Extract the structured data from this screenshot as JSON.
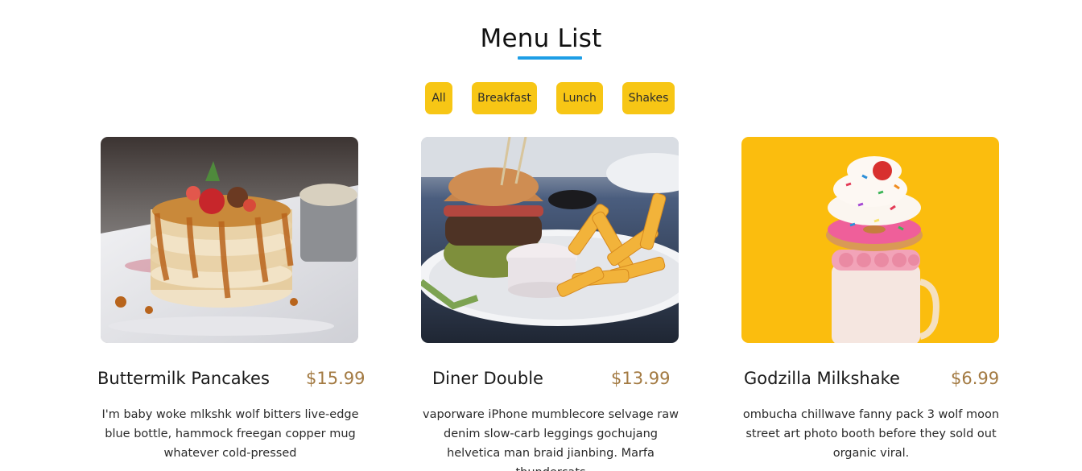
{
  "header": {
    "title": "Menu List"
  },
  "filters": [
    {
      "label": "All"
    },
    {
      "label": "Breakfast"
    },
    {
      "label": "Lunch"
    },
    {
      "label": "Shakes"
    }
  ],
  "menu_items": [
    {
      "name": "Buttermilk Pancakes",
      "price": "$15.99",
      "description": "I'm baby woke mlkshk wolf bitters live-edge blue bottle, hammock freegan copper mug whatever cold-pressed",
      "image_icon": "pancakes-image"
    },
    {
      "name": "Diner Double",
      "price": "$13.99",
      "description": "vaporware iPhone mumblecore selvage raw denim slow-carb leggings gochujang helvetica man braid jianbing. Marfa thundercats",
      "image_icon": "burger-fries-image"
    },
    {
      "name": "Godzilla Milkshake",
      "price": "$6.99",
      "description": "ombucha chillwave fanny pack 3 wolf moon street art photo booth before they sold out organic viral.",
      "image_icon": "milkshake-image"
    }
  ],
  "colors": {
    "accent_underline": "#1e9ee6",
    "filter_button": "#f7c615",
    "price": "#a37a42",
    "shake_background": "#fbbd0e"
  }
}
